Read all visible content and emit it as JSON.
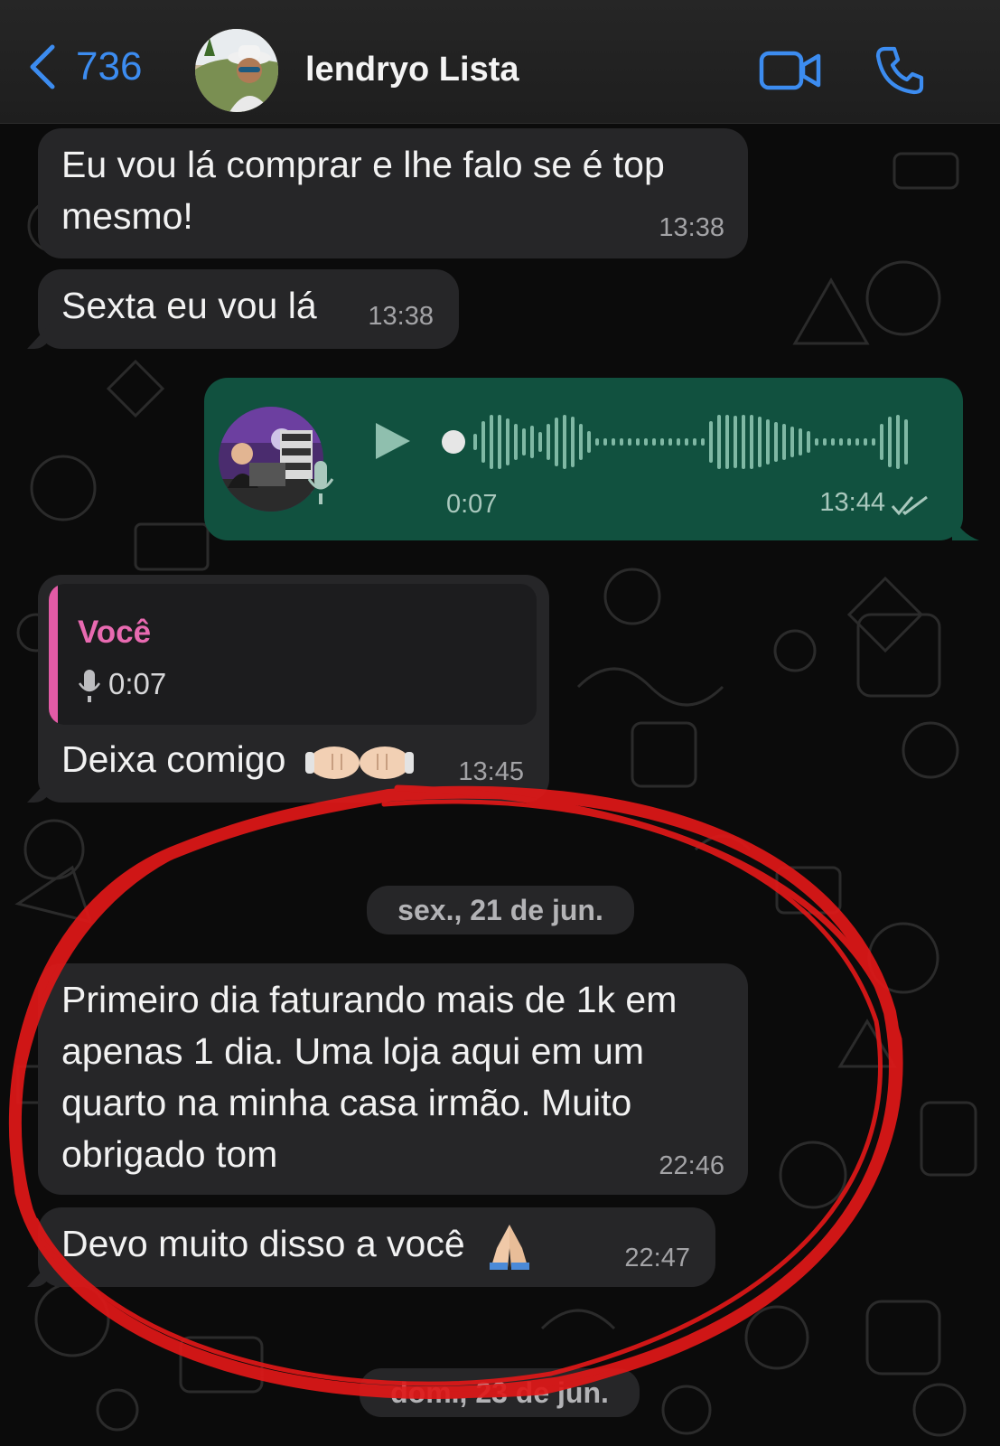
{
  "header": {
    "back_count": "736",
    "contact_name": "lendryo Lista"
  },
  "colors": {
    "accent": "#3c8cf0",
    "incoming_bubble": "#262628",
    "outgoing_bubble": "#11513f",
    "quote_accent": "#e35ba6",
    "annotation": "#e01818"
  },
  "messages": {
    "m1": {
      "text_line1": "Eu vou lá comprar e lhe falo se é top",
      "text_line2": "mesmo!",
      "time": "13:38"
    },
    "m2": {
      "text": "Sexta eu vou lá",
      "time": "13:38"
    },
    "voice": {
      "duration": "0:07",
      "time": "13:44",
      "status": "read"
    },
    "reply": {
      "quote_author": "Você",
      "quote_duration": "0:07",
      "text": "Deixa comigo",
      "emoji": "fist-bump",
      "time": "13:45"
    },
    "date1": "sex., 21 de jun.",
    "m3": {
      "line1": "Primeiro dia faturando mais de 1k em",
      "line2": "apenas 1 dia. Uma loja aqui em um",
      "line3": "quarto na minha casa irmão. Muito",
      "line4": "obrigado tom",
      "time": "22:46"
    },
    "m4": {
      "text": "Devo muito disso a você",
      "emoji": "folded-hands",
      "time": "22:47"
    },
    "date2": "dom., 23 de jun."
  }
}
